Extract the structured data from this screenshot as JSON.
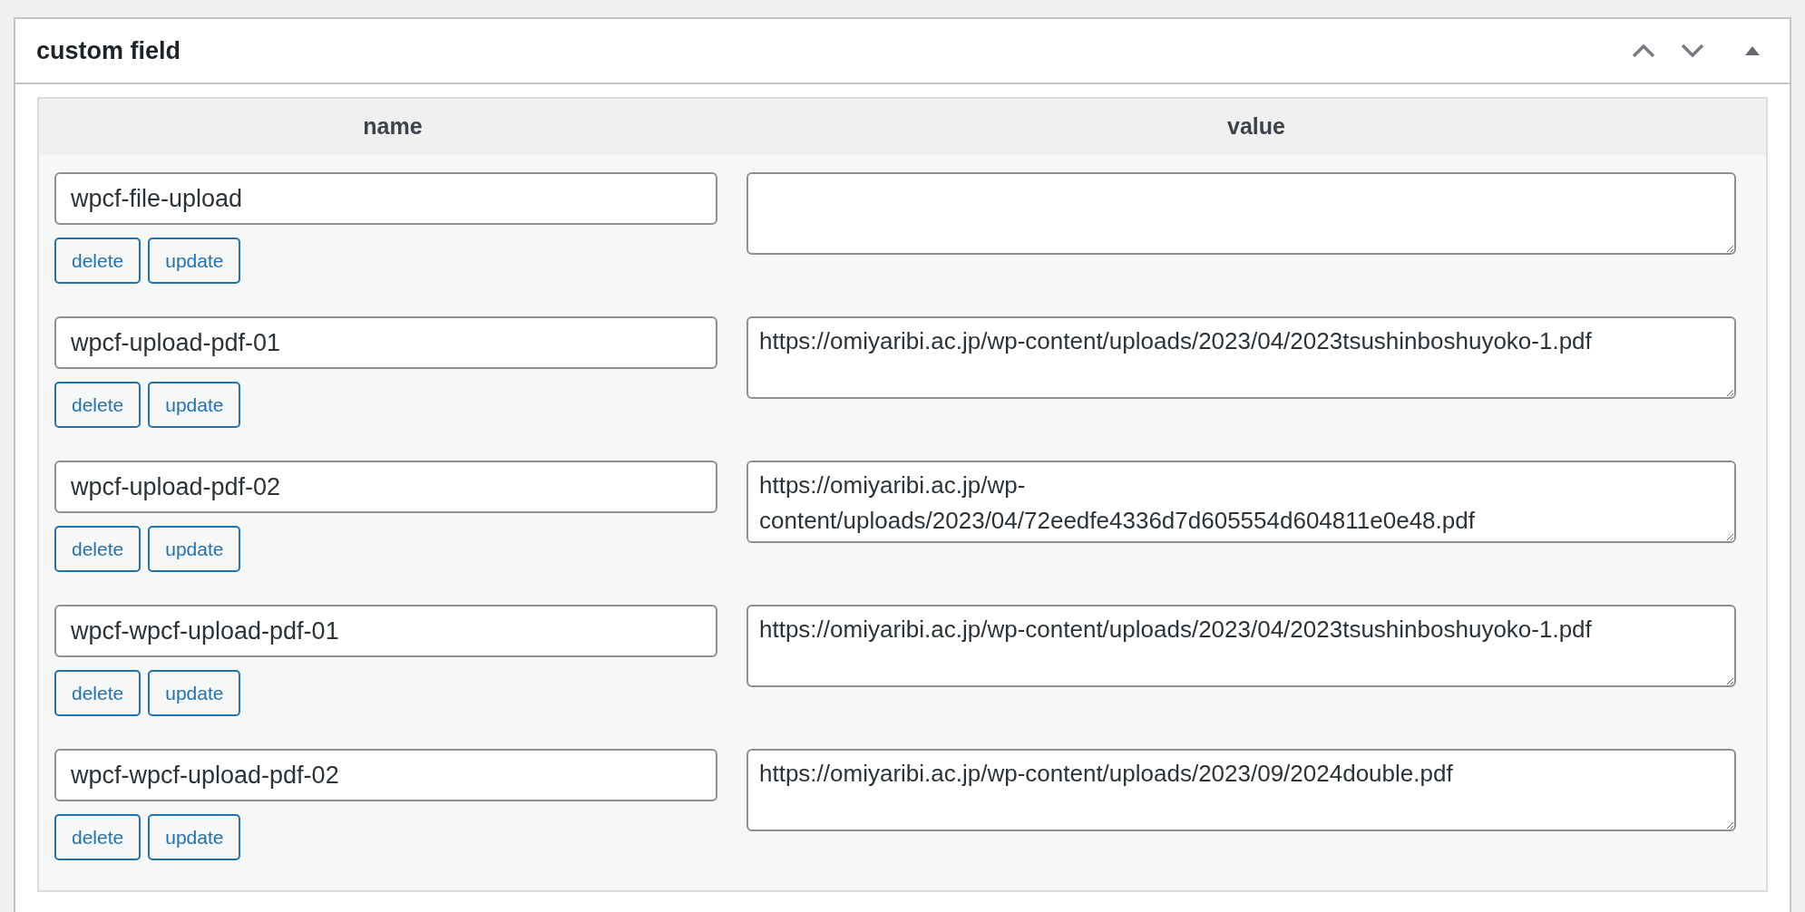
{
  "panel": {
    "title": "custom field"
  },
  "table": {
    "columns": [
      "name",
      "value"
    ],
    "rows": [
      {
        "name": "wpcf-file-upload",
        "value": "",
        "buttons": [
          "delete",
          "update"
        ]
      },
      {
        "name": "wpcf-upload-pdf-01",
        "value": "https://omiyaribi.ac.jp/wp-content/uploads/2023/04/2023tsushinboshuyoko-1.pdf",
        "buttons": [
          "delete",
          "update"
        ]
      },
      {
        "name": "wpcf-upload-pdf-02",
        "value": "https://omiyaribi.ac.jp/wp-content/uploads/2023/04/72eedfe4336d7d605554d604811e0e48.pdf",
        "buttons": [
          "delete",
          "update"
        ]
      },
      {
        "name": "wpcf-wpcf-upload-pdf-01",
        "value": "https://omiyaribi.ac.jp/wp-content/uploads/2023/04/2023tsushinboshuyoko-1.pdf",
        "buttons": [
          "delete",
          "update"
        ]
      },
      {
        "name": "wpcf-wpcf-upload-pdf-02",
        "value": "https://omiyaribi.ac.jp/wp-content/uploads/2023/09/2024double.pdf",
        "buttons": [
          "delete",
          "update"
        ]
      }
    ]
  }
}
